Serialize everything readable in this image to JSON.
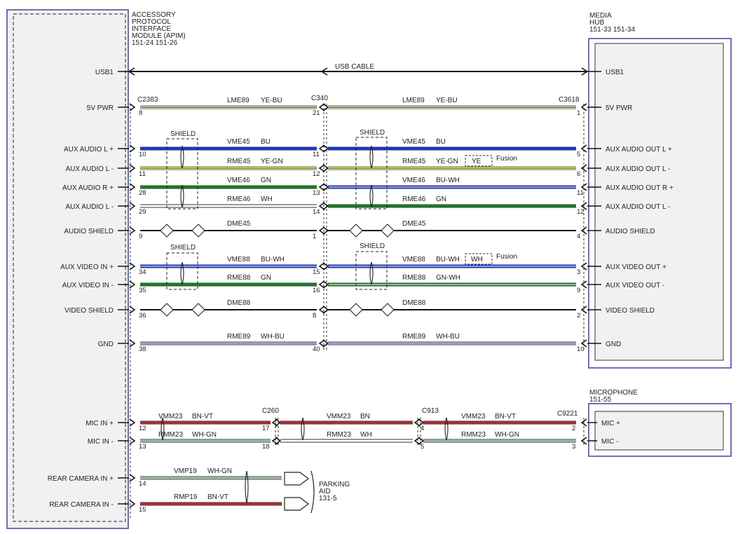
{
  "modules": {
    "apim": {
      "lines": [
        "ACCESSORY",
        "PROTOCOL",
        "INTERFACE",
        "MODULE (APIM)",
        "151-24  151-26"
      ]
    },
    "media_hub": {
      "lines": [
        "MEDIA",
        "HUB",
        "151-33  151-34"
      ]
    },
    "microphone": {
      "lines": [
        "MICROPHONE",
        "151-55"
      ]
    },
    "parking_aid": {
      "lines": [
        "PARKING",
        "AID",
        "131-5"
      ]
    }
  },
  "connectors": {
    "c2383": "C2383",
    "c340": "C340",
    "c3618": "C3618",
    "c260": "C260",
    "c913": "C913",
    "c9221": "C9221"
  },
  "labels": {
    "usb_cable": "USB CABLE",
    "shield": "SHIELD",
    "fusion": "Fusion",
    "fusion_ye": "YE",
    "fusion_wh": "WH"
  },
  "colors": {
    "YE": "#d7dc7a",
    "BU": "#1c35c8",
    "GN": "#1a7a22",
    "BN": "#a42e33",
    "WH": "#ffffff",
    "BK": "#111111"
  },
  "apim_pins": [
    {
      "label": "USB1",
      "pin": ""
    },
    {
      "label": "5V PWR",
      "pin": "8"
    },
    {
      "label": "AUX AUDIO L +",
      "pin": "10"
    },
    {
      "label": "AUX AUDIO L -",
      "pin": "11"
    },
    {
      "label": "AUX AUDIO R +",
      "pin": "28"
    },
    {
      "label": "AUX AUDIO L -",
      "pin": "29"
    },
    {
      "label": "AUDIO SHIELD",
      "pin": "9"
    },
    {
      "label": "AUX VIDEO IN +",
      "pin": "34"
    },
    {
      "label": "AUX VIDEO IN -",
      "pin": "35"
    },
    {
      "label": "VIDEO SHIELD",
      "pin": "36"
    },
    {
      "label": "GND",
      "pin": "38"
    },
    {
      "label": "MIC IN +",
      "pin": "12"
    },
    {
      "label": "MIC IN -",
      "pin": "13"
    },
    {
      "label": "REAR CAMERA IN +",
      "pin": "14"
    },
    {
      "label": "REAR CAMERA IN -",
      "pin": "15"
    }
  ],
  "hub_pins": [
    {
      "label": "USB1",
      "pin": ""
    },
    {
      "label": "5V PWR",
      "pin": "1"
    },
    {
      "label": "AUX AUDIO OUT L +",
      "pin": "5"
    },
    {
      "label": "AUX AUDIO OUT L -",
      "pin": "6"
    },
    {
      "label": "AUX AUDIO OUT R +",
      "pin": "11"
    },
    {
      "label": "AUX AUDIO OUT L -",
      "pin": "12"
    },
    {
      "label": "AUDIO SHIELD",
      "pin": "4"
    },
    {
      "label": "AUX VIDEO OUT +",
      "pin": "3"
    },
    {
      "label": "AUX VIDEO OUT -",
      "pin": "9"
    },
    {
      "label": "VIDEO SHIELD",
      "pin": "2"
    },
    {
      "label": "GND",
      "pin": "10"
    }
  ],
  "c340_pins": [
    "21",
    "11",
    "12",
    "13",
    "14",
    "1",
    "15",
    "16",
    "8",
    "40"
  ],
  "mic_pins": [
    {
      "label": "MIC +",
      "pin": "2"
    },
    {
      "label": "MIC -",
      "pin": "3"
    }
  ],
  "c260_pins": [
    "17",
    "18"
  ],
  "c913_pins": [
    "4",
    "5"
  ],
  "left_circuits": [
    {
      "id": "LME89",
      "color": "YE-BU"
    },
    {
      "id": "VME45",
      "color": "BU"
    },
    {
      "id": "RME45",
      "color": "YE-GN"
    },
    {
      "id": "VME46",
      "color": "GN"
    },
    {
      "id": "RME46",
      "color": "WH"
    },
    {
      "id": "DME45",
      "color": ""
    },
    {
      "id": "VME88",
      "color": "BU-WH"
    },
    {
      "id": "RME88",
      "color": "GN"
    },
    {
      "id": "DME88",
      "color": ""
    },
    {
      "id": "RME89",
      "color": "WH-BU"
    }
  ],
  "right_circuits": [
    {
      "id": "LME89",
      "color": "YE-BU"
    },
    {
      "id": "VME45",
      "color": "BU"
    },
    {
      "id": "RME45",
      "color": "YE-GN"
    },
    {
      "id": "VME46",
      "color": "BU-WH"
    },
    {
      "id": "RME46",
      "color": "GN"
    },
    {
      "id": "DME45",
      "color": ""
    },
    {
      "id": "VME88",
      "color": "BU-WH"
    },
    {
      "id": "RME88",
      "color": "GN-WH"
    },
    {
      "id": "DME88",
      "color": ""
    },
    {
      "id": "RME89",
      "color": "WH-BU"
    }
  ],
  "mic_circuits": [
    {
      "id": "VMM23",
      "color": "BN-VT"
    },
    {
      "id": "RMM23",
      "color": "WH-GN"
    },
    {
      "id": "VMM23",
      "color": "BN"
    },
    {
      "id": "RMM23",
      "color": "WH"
    },
    {
      "id": "VMM23",
      "color": "BN-VT"
    },
    {
      "id": "RMM23",
      "color": "WH-GN"
    }
  ],
  "camera_circuits": [
    {
      "id": "VMP19",
      "color": "WH-GN"
    },
    {
      "id": "RMP19",
      "color": "BN-VT"
    }
  ]
}
